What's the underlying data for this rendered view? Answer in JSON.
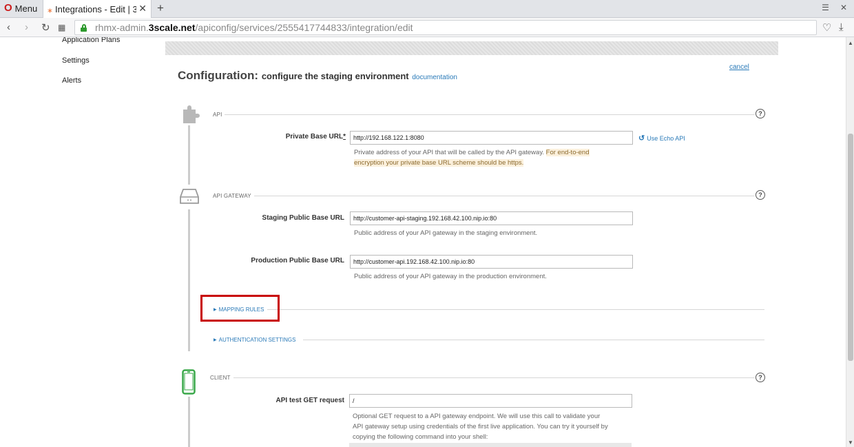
{
  "browser": {
    "menu_label": "Menu",
    "tab_title": "Integrations - Edit | 3",
    "url_prefix": "rhmx-admin.",
    "url_host": "3scale.net",
    "url_path": "/apiconfig/services/2555417744833/integration/edit"
  },
  "sidebar": {
    "items": [
      {
        "label": "Application Plans"
      },
      {
        "label": "Settings"
      },
      {
        "label": "Alerts"
      }
    ]
  },
  "heading": {
    "title": "Configuration:",
    "subtitle": "configure the staging environment",
    "documentation_link": "documentation",
    "cancel_link": "cancel"
  },
  "api_section": {
    "label": "API",
    "private_url_label": "Private Base URL",
    "private_url_required": "*",
    "private_url_value": "http://192.168.122.1:8080",
    "echo_link": "Use Echo API",
    "hint_plain": "Private address of your API that will be called by the API gateway.",
    "hint_highlight_1": "For end-to-end",
    "hint_highlight_2": "encryption your private base URL scheme should be https."
  },
  "gateway_section": {
    "label": "API GATEWAY",
    "staging_label": "Staging Public Base URL",
    "staging_value": "http://customer-api-staging.192.168.42.100.nip.io:80",
    "staging_hint": "Public address of your API gateway in the staging environment.",
    "production_label": "Production Public Base URL",
    "production_value": "http://customer-api.192.168.42.100.nip.io:80",
    "production_hint": "Public address of your API gateway in the production environment.",
    "mapping_rules": "MAPPING RULES",
    "auth_settings": "AUTHENTICATION SETTINGS"
  },
  "client_section": {
    "label": "CLIENT",
    "test_label": "API test GET request",
    "test_value": "/",
    "hint_line1": "Optional GET request to a API gateway endpoint. We will use this call to validate your",
    "hint_line2": "API gateway setup using credentials of the first live application. You can try it yourself by",
    "hint_line3": "copying the following command into your shell:"
  },
  "help_glyph": "?",
  "colors": {
    "link": "#2a7ab8",
    "client_icon": "#3aa84a",
    "highlight_border": "#c80000",
    "hint_highlight_bg": "#fbf0dc"
  }
}
